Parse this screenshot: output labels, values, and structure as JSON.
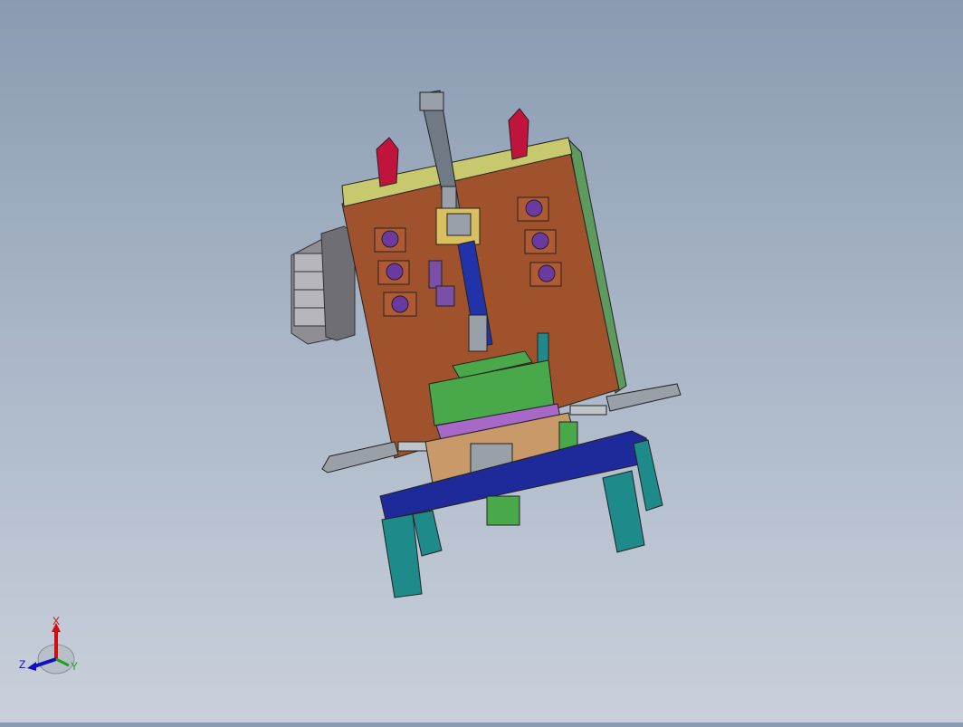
{
  "viewport": {
    "background_top": "#8a9bb1",
    "background_bottom": "#c9d0db"
  },
  "model": {
    "colors": {
      "back_plate": "#a0522d",
      "top_strip": "#c8c86e",
      "side_plate": "#5e9a5e",
      "base_plate": "#1e2a9a",
      "legs": "#1f8a8a",
      "cylinder": "#707a85",
      "handles": "#c0143c",
      "blocks": "#7b4ea8",
      "carriage": "#49a84a",
      "slide_rail": "#2233aa",
      "gray_parts": "#9aa0a8"
    }
  },
  "triad": {
    "x_label": "X",
    "y_label": "Y",
    "z_label": "Z",
    "x_color": "#d01010",
    "y_color": "#20a020",
    "z_color": "#1010c0"
  }
}
